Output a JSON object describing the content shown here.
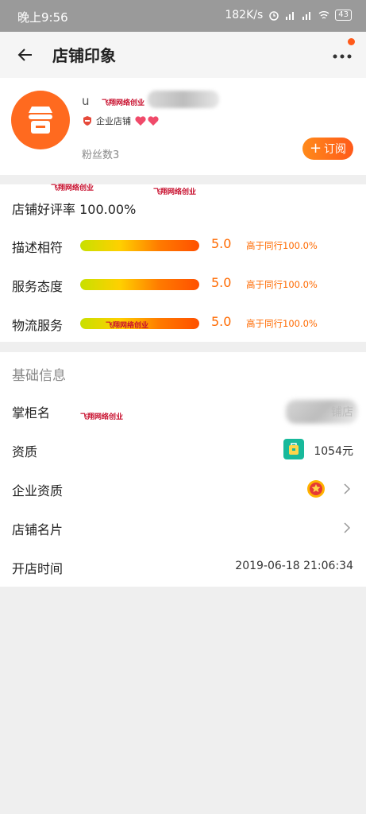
{
  "status_bar": {
    "time": "晚上9:56",
    "speed": "182K/s",
    "battery": "43"
  },
  "header": {
    "title": "店铺印象"
  },
  "shop": {
    "name_visible": "u",
    "enterprise_label": "企业店铺",
    "fans": "粉丝数3",
    "subscribe_label": "订阅"
  },
  "watermark": "飞翔网络创业",
  "ratings": {
    "good_rate": "店铺好评率 100.00%",
    "items": [
      {
        "label": "描述相符",
        "score": "5.0",
        "compare": "高于同行100.0%",
        "fill": 1.0
      },
      {
        "label": "服务态度",
        "score": "5.0",
        "compare": "高于同行100.0%",
        "fill": 1.0
      },
      {
        "label": "物流服务",
        "score": "5.0",
        "compare": "高于同行100.0%",
        "fill": 1.0
      }
    ]
  },
  "basic_info": {
    "title": "基础信息",
    "keeper_label": "掌柜名",
    "keeper_value": "铺店",
    "qualification_label": "资质",
    "qualification_value": "1054元",
    "enterprise_qual_label": "企业资质",
    "card_label": "店铺名片",
    "open_time_label": "开店时间",
    "open_time_value": "2019-06-18 21:06:34"
  },
  "colors": {
    "accent": "#ff6a1f",
    "score": "#ff6a00",
    "status_bar": "#9a9a9a"
  }
}
